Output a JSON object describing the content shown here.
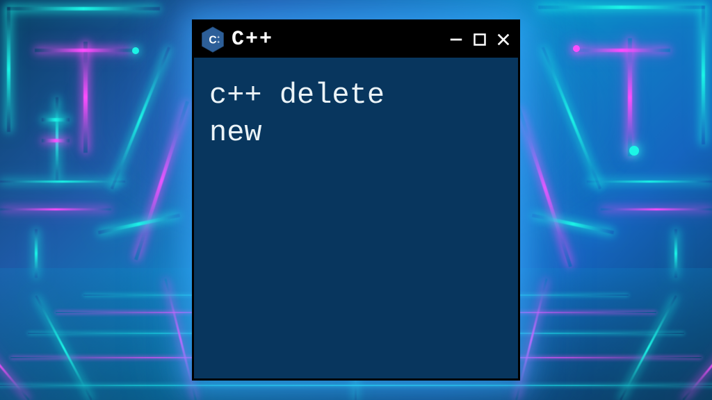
{
  "window": {
    "title": "C++",
    "icon": "cpp-hexagon-icon",
    "controls": {
      "minimize": "minimize",
      "maximize": "maximize",
      "close": "close"
    }
  },
  "content": {
    "line1": "c++ delete",
    "line2": "new"
  },
  "colors": {
    "window_bg": "#08365e",
    "titlebar_bg": "#000000",
    "text": "#ebf3f7",
    "neon_cyan": "#1bf5e6",
    "neon_magenta": "#ff4dff",
    "icon_blue": "#2d5f99"
  }
}
